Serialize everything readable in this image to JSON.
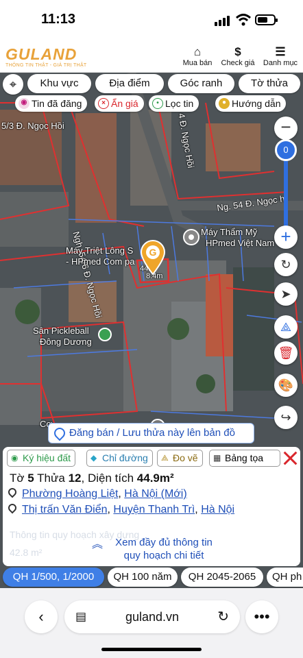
{
  "status": {
    "time": "11:13"
  },
  "header": {
    "brand": "GULAND",
    "tagline": "THÔNG TIN THẬT - GIÁ TRỊ THẬT",
    "buttons": [
      {
        "label": "Mua bán",
        "icon": "house-icon"
      },
      {
        "label": "Check giá",
        "icon": "dollar-icon"
      },
      {
        "label": "Danh mục",
        "icon": "menu-icon"
      }
    ]
  },
  "map_filters": [
    "Khu vực",
    "Địa điểm",
    "Góc ranh",
    "Tờ thửa"
  ],
  "chips": [
    {
      "label": "Tin đã đăng",
      "icon": "palette-icon"
    },
    {
      "label": "Ẩn giá",
      "icon": "hide-icon"
    },
    {
      "label": "Lọc tin",
      "icon": "location-icon"
    },
    {
      "label": "Hướng dẫn",
      "icon": "guide-icon"
    }
  ],
  "zoom_level": "0",
  "map_labels": {
    "street1": "5/3 Đ. Ngọc Hồi",
    "street2": "Ngh. 54/6 Đ. Ngọc Hồi",
    "street3": "4 Đ. Ngọc Hồi",
    "street4": "Ng. 54 Đ. Ngọc h",
    "poi1": "Máy Thẩm Mỹ",
    "poi1b": "HPmed Việt Nam",
    "poi2": "Máy Triệt Lông S",
    "poi2b": "- HPmed Com pa",
    "poi3": "Sân Pickleball",
    "poi3b": "Đông Dương",
    "plot_area_short": "44.9",
    "plot_dim": "8.4m",
    "bottom_label": "Cơ"
  },
  "post_bar": "Đăng bán / Lưu thửa này lên bản đồ",
  "panel": {
    "tabs": [
      {
        "label": "Ký hiệu đất",
        "icon": "palette-icon"
      },
      {
        "label": "Chỉ đường",
        "icon": "direction-icon"
      },
      {
        "label": "Đo vẽ",
        "icon": "ruler-icon"
      },
      {
        "label": "Bảng tọa độ",
        "icon": "table-icon"
      }
    ],
    "sheet_prefix": "Tờ",
    "sheet": "5",
    "plot_prefix": "Thửa",
    "plot": "12",
    "area_prefix": ", Diện tích",
    "area": "44.9m²",
    "addr_new_ward": "Phường Hoàng Liệt",
    "addr_new_city": "Hà Nội (Mới)",
    "addr_old_town": "Thị trấn Văn Điển",
    "addr_old_district": "Huyện Thanh Trì",
    "addr_old_city": "Hà Nội",
    "faded_title": "Thông tin quy hoạch xây dựng",
    "faded_value": "42.8 m²",
    "more_line1": "Xem đầy đủ thông tin",
    "more_line2": "quy hoạch chi tiết"
  },
  "qh_tabs": [
    "QH 1/500, 1/2000",
    "QH 100 năm",
    "QH 2045-2065",
    "QH ph"
  ],
  "browser": {
    "url": "guland.vn"
  },
  "colors": {
    "accent": "#3f7fe6",
    "brand": "#e8a23a",
    "close": "#d9262c",
    "plot_border": "#e03030"
  }
}
